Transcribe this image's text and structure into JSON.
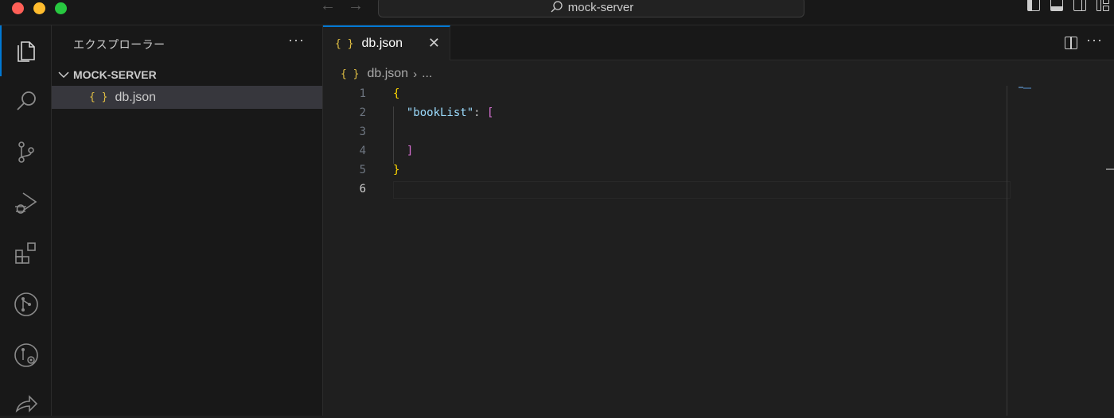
{
  "window": {
    "command_center": "mock-server",
    "nav_back": "←",
    "nav_forward": "→"
  },
  "activity_bar": {
    "items": [
      "explorer",
      "search",
      "source-control",
      "run-and-debug",
      "extensions",
      "git-graph",
      "git-history",
      "remote"
    ],
    "active": "explorer"
  },
  "sidebar": {
    "title": "エクスプローラー",
    "more": "···",
    "folder": "MOCK-SERVER",
    "files": [
      {
        "icon": "{ }",
        "name": "db.json"
      }
    ]
  },
  "editor": {
    "tab": {
      "icon": "{ }",
      "label": "db.json",
      "close": "✕"
    },
    "more": "···",
    "breadcrumb": {
      "icon": "{ }",
      "file": "db.json",
      "separator": "›",
      "rest": "..."
    },
    "line_numbers": [
      "1",
      "2",
      "3",
      "4",
      "5",
      "6"
    ],
    "lines": {
      "l1_brace": "{",
      "l2_key": "\"bookList\"",
      "l2_colon": ": ",
      "l2_bracket": "[",
      "l4_bracket": "]",
      "l5_brace": "}"
    }
  },
  "colors": {
    "accent": "#0078d4",
    "json_icon": "#e2c044",
    "brace": "#ffd700",
    "bracket": "#da70d6",
    "key": "#9cdcfe"
  }
}
